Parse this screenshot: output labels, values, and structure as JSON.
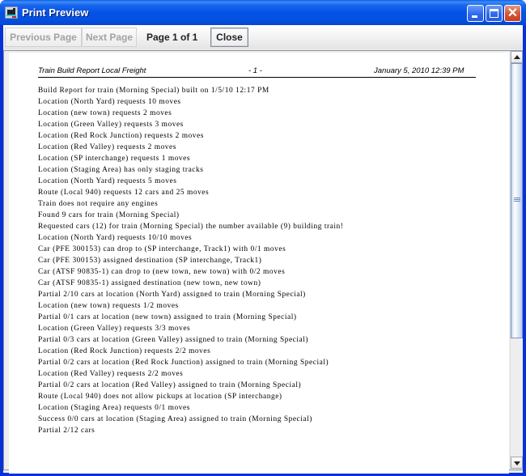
{
  "window": {
    "title": "Print Preview",
    "app_icon": "train-locomotive-icon",
    "controls": {
      "minimize_icon": "minimize-icon",
      "maximize_icon": "maximize-icon",
      "close_icon": "close-icon",
      "close_glyph": "✕"
    }
  },
  "toolbar": {
    "previous_label": "Previous Page",
    "next_label": "Next Page",
    "page_label": "Page 1 of 1",
    "close_label": "Close",
    "previous_enabled": false,
    "next_enabled": false
  },
  "document": {
    "header": {
      "left": "Train Build Report Local Freight",
      "center": "- 1 -",
      "right": "January 5, 2010 12:39 PM"
    },
    "lines": [
      "Build Report for train (Morning Special) built on 1/5/10 12:17 PM",
      "Location (North Yard) requests 10 moves",
      "Location (new town) requests 2 moves",
      "Location (Green Valley) requests 3 moves",
      "Location (Red Rock Junction) requests 2 moves",
      "Location (Red Valley) requests 2 moves",
      "Location (SP interchange) requests 1 moves",
      "Location (Staging Area) has only staging tracks",
      "Location (North Yard) requests 5 moves",
      "Route (Local 940) requests 12 cars and 25 moves",
      "Train does not require any engines",
      "Found 9 cars for train (Morning Special)",
      "Requested cars (12) for train (Morning Special) the number available (9) building train!",
      "Location (North Yard) requests 10/10 moves",
      "Car (PFE 300153) can drop to (SP interchange, Track1) with 0/1 moves",
      "Car (PFE 300153) assigned destination (SP interchange, Track1)",
      "Car (ATSF 90835-1) can drop to (new town, new town) with 0/2 moves",
      "Car (ATSF 90835-1) assigned destination (new town, new town)",
      "Partial 2/10 cars at location (North Yard) assigned to train (Morning Special)",
      "Location (new town) requests 1/2 moves",
      "Partial 0/1 cars at location (new town) assigned to train (Morning Special)",
      "Location (Green Valley) requests 3/3 moves",
      "Partial 0/3 cars at location (Green Valley) assigned to train (Morning Special)",
      "Location (Red Rock Junction) requests 2/2 moves",
      "Partial 0/2 cars at location (Red Rock Junction) assigned to train (Morning Special)",
      "Location (Red Valley) requests 2/2 moves",
      "Partial 0/2 cars at location (Red Valley) assigned to train (Morning Special)",
      "Route (Local 940) does not allow pickups at location (SP interchange)",
      "Location (Staging Area) requests 0/1 moves",
      "Success 0/0 cars at location (Staging Area) assigned to train (Morning Special)",
      "Partial 2/12 cars"
    ]
  },
  "scrollbar": {
    "up_icon": "scroll-up-arrow-icon",
    "down_icon": "scroll-down-arrow-icon",
    "position_fraction": 0.0,
    "visible_fraction": 0.7
  },
  "colors": {
    "titlebar": "#0453e6",
    "close_button": "#d8573a",
    "disabled_text": "#a3a3a3"
  }
}
